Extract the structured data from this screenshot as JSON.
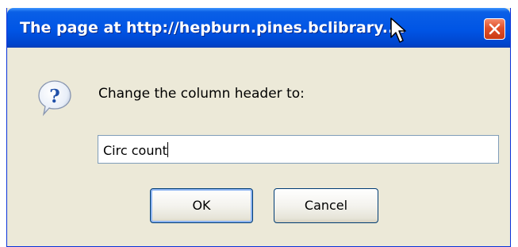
{
  "window": {
    "title": "The page at http://hepburn.pines.bclibrary...."
  },
  "dialog": {
    "prompt": "Change the column header to:",
    "input_value": "Circ count",
    "ok_label": "OK",
    "cancel_label": "Cancel"
  },
  "icons": {
    "close": "close-icon",
    "question": "question-icon",
    "cursor": "mouse-cursor-icon"
  },
  "colors": {
    "titlebar": "#0055e5",
    "dialog_bg": "#ece9d8",
    "close_button": "#e0502a",
    "button_border": "#003c74"
  }
}
